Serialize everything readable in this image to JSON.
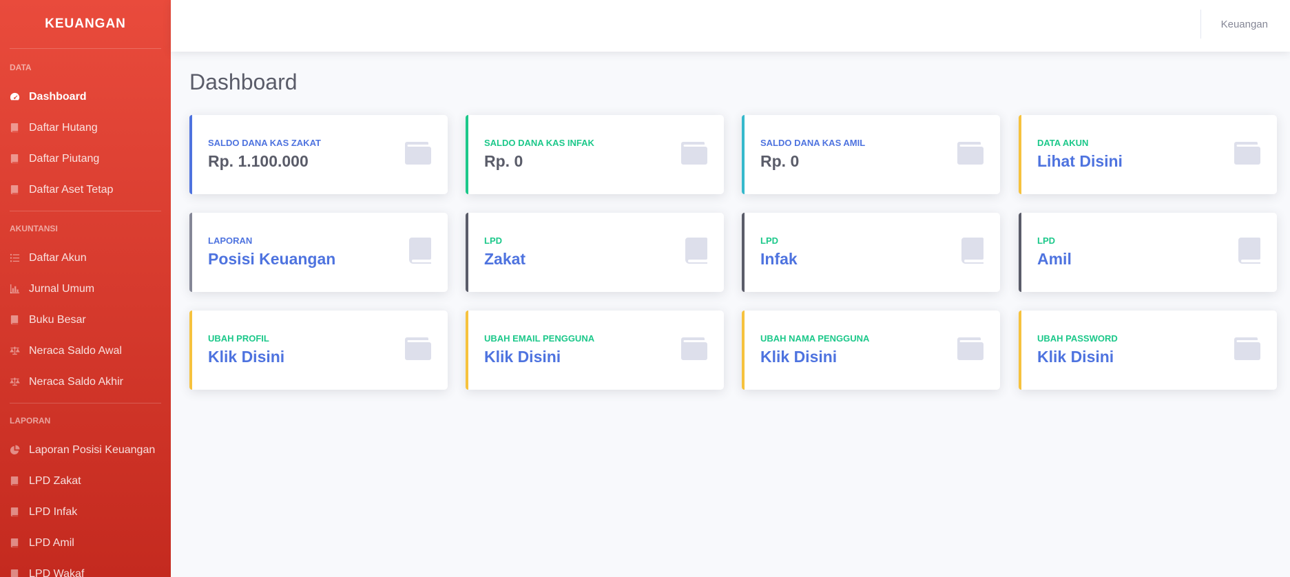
{
  "sidebar": {
    "brand": "KEUANGAN",
    "sections": [
      {
        "heading": "DATA",
        "items": [
          {
            "label": "Dashboard",
            "icon": "dashboard-icon",
            "active": true
          },
          {
            "label": "Daftar Hutang",
            "icon": "book-icon"
          },
          {
            "label": "Daftar Piutang",
            "icon": "book-icon"
          },
          {
            "label": "Daftar Aset Tetap",
            "icon": "book-icon"
          }
        ]
      },
      {
        "heading": "AKUNTANSI",
        "items": [
          {
            "label": "Daftar Akun",
            "icon": "list-icon"
          },
          {
            "label": "Jurnal Umum",
            "icon": "chart-icon"
          },
          {
            "label": "Buku Besar",
            "icon": "book-icon"
          },
          {
            "label": "Neraca Saldo Awal",
            "icon": "balance-scale-icon"
          },
          {
            "label": "Neraca Saldo Akhir",
            "icon": "balance-scale-icon"
          }
        ]
      },
      {
        "heading": "LAPORAN",
        "items": [
          {
            "label": "Laporan Posisi Keuangan",
            "icon": "pie-chart-icon"
          },
          {
            "label": "LPD Zakat",
            "icon": "book-icon"
          },
          {
            "label": "LPD Infak",
            "icon": "book-icon"
          },
          {
            "label": "LPD Amil",
            "icon": "book-icon"
          },
          {
            "label": "LPD Wakaf",
            "icon": "book-icon"
          }
        ]
      }
    ]
  },
  "topbar": {
    "user": "Keuangan"
  },
  "page": {
    "title": "Dashboard"
  },
  "cards": [
    {
      "label": "SALDO DANA KAS ZAKAT",
      "value": "Rp. 1.100.000",
      "style": "dark",
      "accent": "#4e73df",
      "label_color": "#4e73df",
      "icon": "wallet-icon"
    },
    {
      "label": "SALDO DANA KAS INFAK",
      "value": "Rp. 0",
      "style": "dark",
      "accent": "#1cc88a",
      "label_color": "#1cc88a",
      "icon": "wallet-icon"
    },
    {
      "label": "SALDO DANA KAS AMIL",
      "value": "Rp. 0",
      "style": "dark",
      "accent": "#36b9cc",
      "label_color": "#4e73df",
      "icon": "wallet-icon"
    },
    {
      "label": "DATA AKUN",
      "value": "Lihat Disini",
      "style": "link",
      "accent": "#f6c23e",
      "label_color": "#1cc88a",
      "icon": "wallet-icon"
    },
    {
      "label": "LAPORAN",
      "value": "Posisi Keuangan",
      "style": "link",
      "accent": "#858796",
      "label_color": "#4e73df",
      "icon": "book-icon"
    },
    {
      "label": "LPD",
      "value": "Zakat",
      "style": "link",
      "accent": "#5a5c69",
      "label_color": "#1cc88a",
      "icon": "book-icon"
    },
    {
      "label": "LPD",
      "value": "Infak",
      "style": "link",
      "accent": "#5a5c69",
      "label_color": "#1cc88a",
      "icon": "book-icon"
    },
    {
      "label": "LPD",
      "value": "Amil",
      "style": "link",
      "accent": "#5a5c69",
      "label_color": "#1cc88a",
      "icon": "book-icon"
    },
    {
      "label": "UBAH PROFIL",
      "value": "Klik Disini",
      "style": "link",
      "accent": "#f6c23e",
      "label_color": "#1cc88a",
      "icon": "wallet-icon"
    },
    {
      "label": "UBAH EMAIL PENGGUNA",
      "value": "Klik Disini",
      "style": "link",
      "accent": "#f6c23e",
      "label_color": "#1cc88a",
      "icon": "wallet-icon"
    },
    {
      "label": "UBAH NAMA PENGGUNA",
      "value": "Klik Disini",
      "style": "link",
      "accent": "#f6c23e",
      "label_color": "#1cc88a",
      "icon": "wallet-icon"
    },
    {
      "label": "UBAH PASSWORD",
      "value": "Klik Disini",
      "style": "link",
      "accent": "#f6c23e",
      "label_color": "#1cc88a",
      "icon": "wallet-icon"
    }
  ]
}
